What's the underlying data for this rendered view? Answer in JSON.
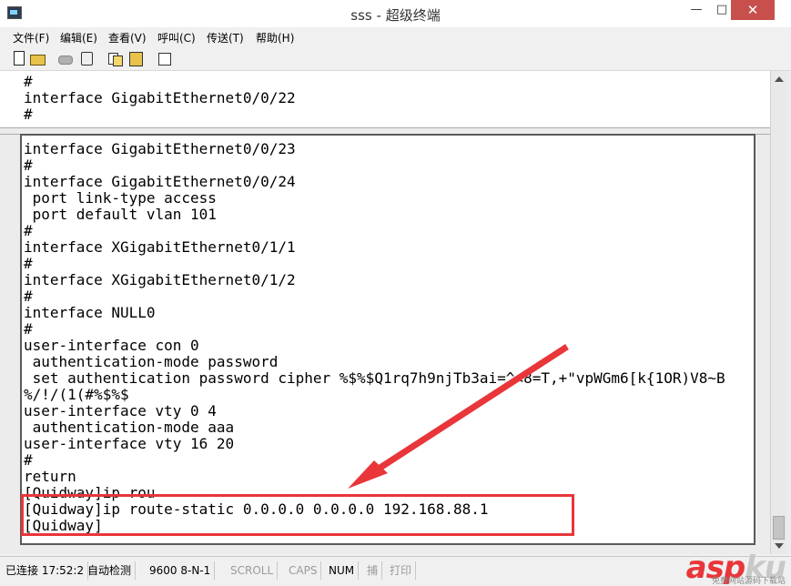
{
  "window": {
    "title": "sss - 超级终端",
    "min_glyph": "—",
    "max_glyph": "□",
    "close_glyph": "✕"
  },
  "menu": [
    {
      "label": "文件(F)"
    },
    {
      "label": "编辑(E)"
    },
    {
      "label": "查看(V)"
    },
    {
      "label": "呼叫(C)"
    },
    {
      "label": "传送(T)"
    },
    {
      "label": "帮助(H)"
    }
  ],
  "toolbar": {
    "icons": [
      "new-icon",
      "open-icon",
      "phone-icon",
      "disconnect-icon",
      "send-icon",
      "receive-icon",
      "properties-icon"
    ]
  },
  "terminal": {
    "upper_lines": [
      "#",
      "interface GigabitEthernet0/0/22",
      "#"
    ],
    "lower_lines": [
      "interface GigabitEthernet0/0/23",
      "#",
      "interface GigabitEthernet0/0/24",
      " port link-type access",
      " port default vlan 101",
      "#",
      "interface XGigabitEthernet0/1/1",
      "#",
      "interface XGigabitEthernet0/1/2",
      "#",
      "interface NULL0",
      "#",
      "user-interface con 0",
      " authentication-mode password",
      " set authentication password cipher %$%$Q1rq7h9njTb3ai=^<8=T,+\"vpWGm6[k{1OR)V8~B",
      "%/!/(1(#%$%$",
      "user-interface vty 0 4",
      " authentication-mode aaa",
      "user-interface vty 16 20",
      "#",
      "return",
      "[Quidway]ip rou",
      "[Quidway]ip route-static 0.0.0.0 0.0.0.0 192.168.88.1",
      "[Quidway]"
    ],
    "cursor": "_",
    "scroll_position": 0.95
  },
  "colors": {
    "annotation": "#e8363a"
  },
  "status": {
    "connection": "已连接 17:52:2",
    "detect": "自动检测",
    "port": "9600 8-N-1",
    "scroll": "SCROLL",
    "caps": "CAPS",
    "num": "NUM",
    "capture": "捕",
    "print": "打印"
  },
  "watermark": {
    "brand_red": "asp",
    "brand_gray": "ku",
    "tagline": "免费网站源码下载站"
  }
}
